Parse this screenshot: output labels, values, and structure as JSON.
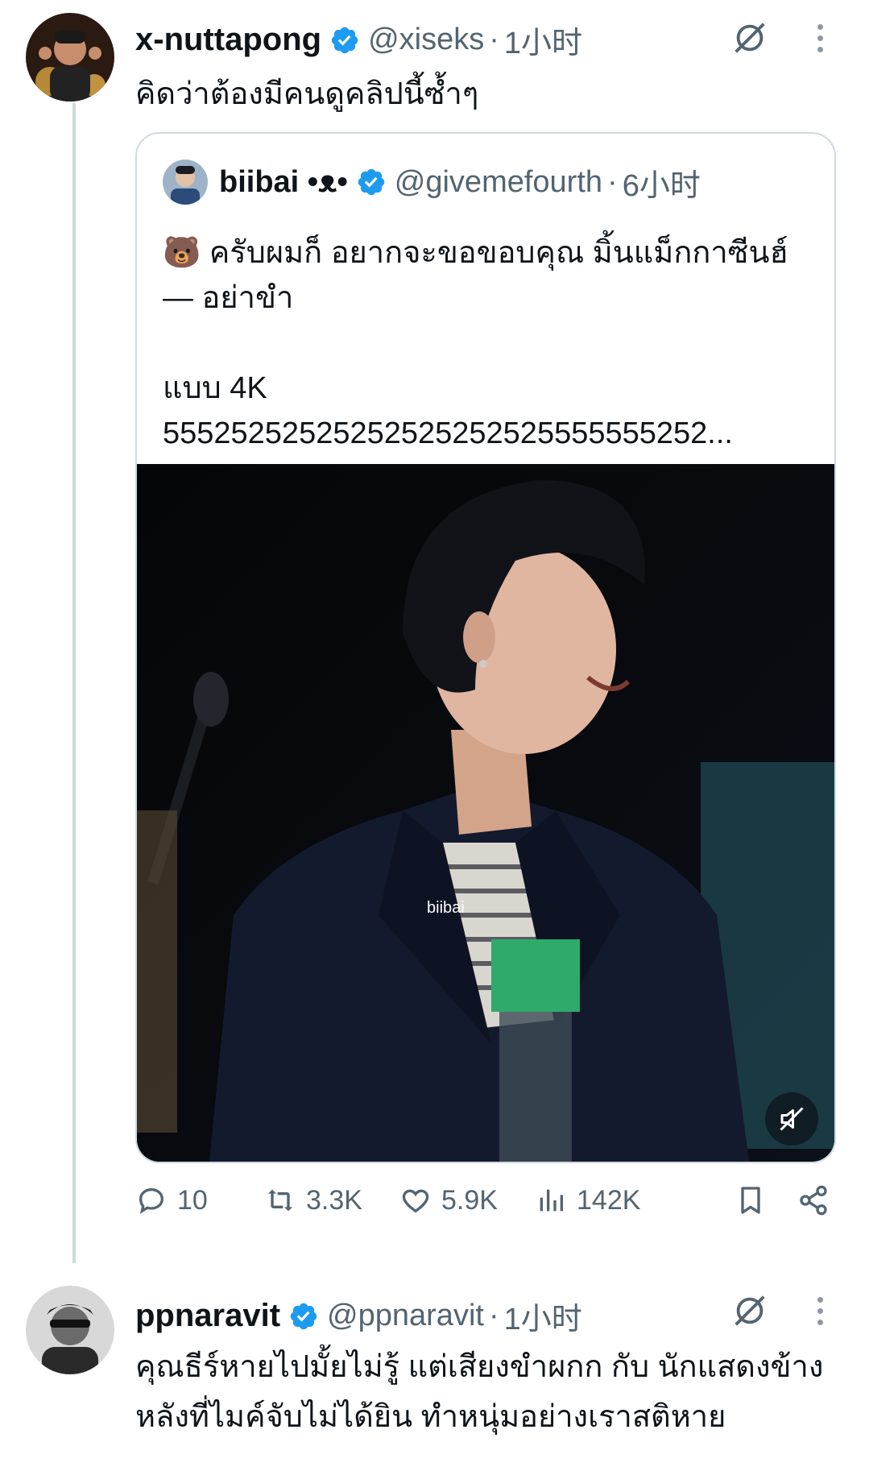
{
  "tweet1": {
    "name": "x-nuttapong",
    "handle": "@xiseks",
    "separator": "·",
    "time": "1小时",
    "text": "คิดว่าต้องมีคนดูคลิปนี้ซ้ำๆ"
  },
  "quote": {
    "name": "biibai •ᴥ•",
    "handle": "@givemefourth",
    "separator": "·",
    "time": "6小时",
    "line1": "🐻 ครับผมก็ อยากจะขอขอบคุณ มิ้นแม็กกาซีนฮ์— อย่าขำ",
    "line2": "แบบ 4K",
    "line3": "55525252525252525252525555555252...",
    "media_watermark": "biibai"
  },
  "actions": {
    "replies": "10",
    "retweets": "3.3K",
    "likes": "5.9K",
    "views": "142K"
  },
  "tweet2": {
    "name": "ppnaravit",
    "handle": "@ppnaravit",
    "separator": "·",
    "time": "1小时",
    "text": "คุณธีร์หายไปมั้ยไม่รู้ แต่เสียงขำผกก กับ นักแสดงข้างหลังที่ไมค์จับไม่ได้ยิน ทำหนุ่มอย่างเราสติหาย"
  },
  "colors": {
    "verified": "#1d9bf0",
    "secondary_text": "#536471",
    "border": "#cfd9de"
  }
}
